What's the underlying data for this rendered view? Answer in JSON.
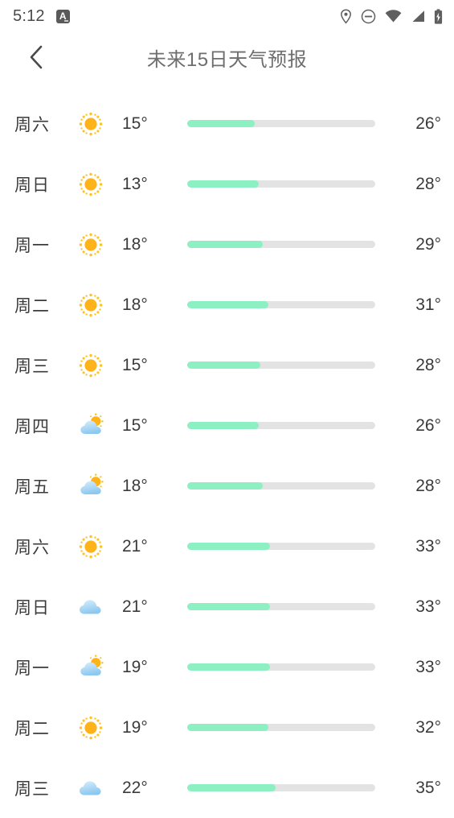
{
  "status_bar": {
    "time": "5:12",
    "app_badge_letter": "A",
    "icons": [
      "location-pin-icon",
      "do-not-disturb-icon",
      "wifi-icon",
      "cellular-signal-icon",
      "battery-charging-icon"
    ]
  },
  "header": {
    "back_icon": "chevron-left-icon",
    "title": "未来15日天气预报"
  },
  "colors": {
    "bar_fill": "#8cf0c3",
    "bar_track": "#e3e3e3",
    "text": "#3b3b3b",
    "title": "#6e6e6e",
    "sun": "#ffb31a",
    "cloud": "#bfe0f7"
  },
  "forecast": {
    "rows": [
      {
        "day": "周六",
        "icon": "sun-icon",
        "temp_min": "15°",
        "temp_max": "26°",
        "fill_percent": 36
      },
      {
        "day": "周日",
        "icon": "sun-icon",
        "temp_min": "13°",
        "temp_max": "28°",
        "fill_percent": 38
      },
      {
        "day": "周一",
        "icon": "sun-icon",
        "temp_min": "18°",
        "temp_max": "29°",
        "fill_percent": 40
      },
      {
        "day": "周二",
        "icon": "sun-icon",
        "temp_min": "18°",
        "temp_max": "31°",
        "fill_percent": 43
      },
      {
        "day": "周三",
        "icon": "sun-icon",
        "temp_min": "15°",
        "temp_max": "28°",
        "fill_percent": 39
      },
      {
        "day": "周四",
        "icon": "partly-cloudy-icon",
        "temp_min": "15°",
        "temp_max": "26°",
        "fill_percent": 38
      },
      {
        "day": "周五",
        "icon": "partly-cloudy-icon",
        "temp_min": "18°",
        "temp_max": "28°",
        "fill_percent": 40
      },
      {
        "day": "周六",
        "icon": "sun-icon",
        "temp_min": "21°",
        "temp_max": "33°",
        "fill_percent": 44
      },
      {
        "day": "周日",
        "icon": "cloud-icon",
        "temp_min": "21°",
        "temp_max": "33°",
        "fill_percent": 44
      },
      {
        "day": "周一",
        "icon": "partly-cloudy-icon",
        "temp_min": "19°",
        "temp_max": "33°",
        "fill_percent": 44
      },
      {
        "day": "周二",
        "icon": "sun-icon",
        "temp_min": "19°",
        "temp_max": "32°",
        "fill_percent": 43
      },
      {
        "day": "周三",
        "icon": "cloud-icon",
        "temp_min": "22°",
        "temp_max": "35°",
        "fill_percent": 47
      }
    ]
  }
}
